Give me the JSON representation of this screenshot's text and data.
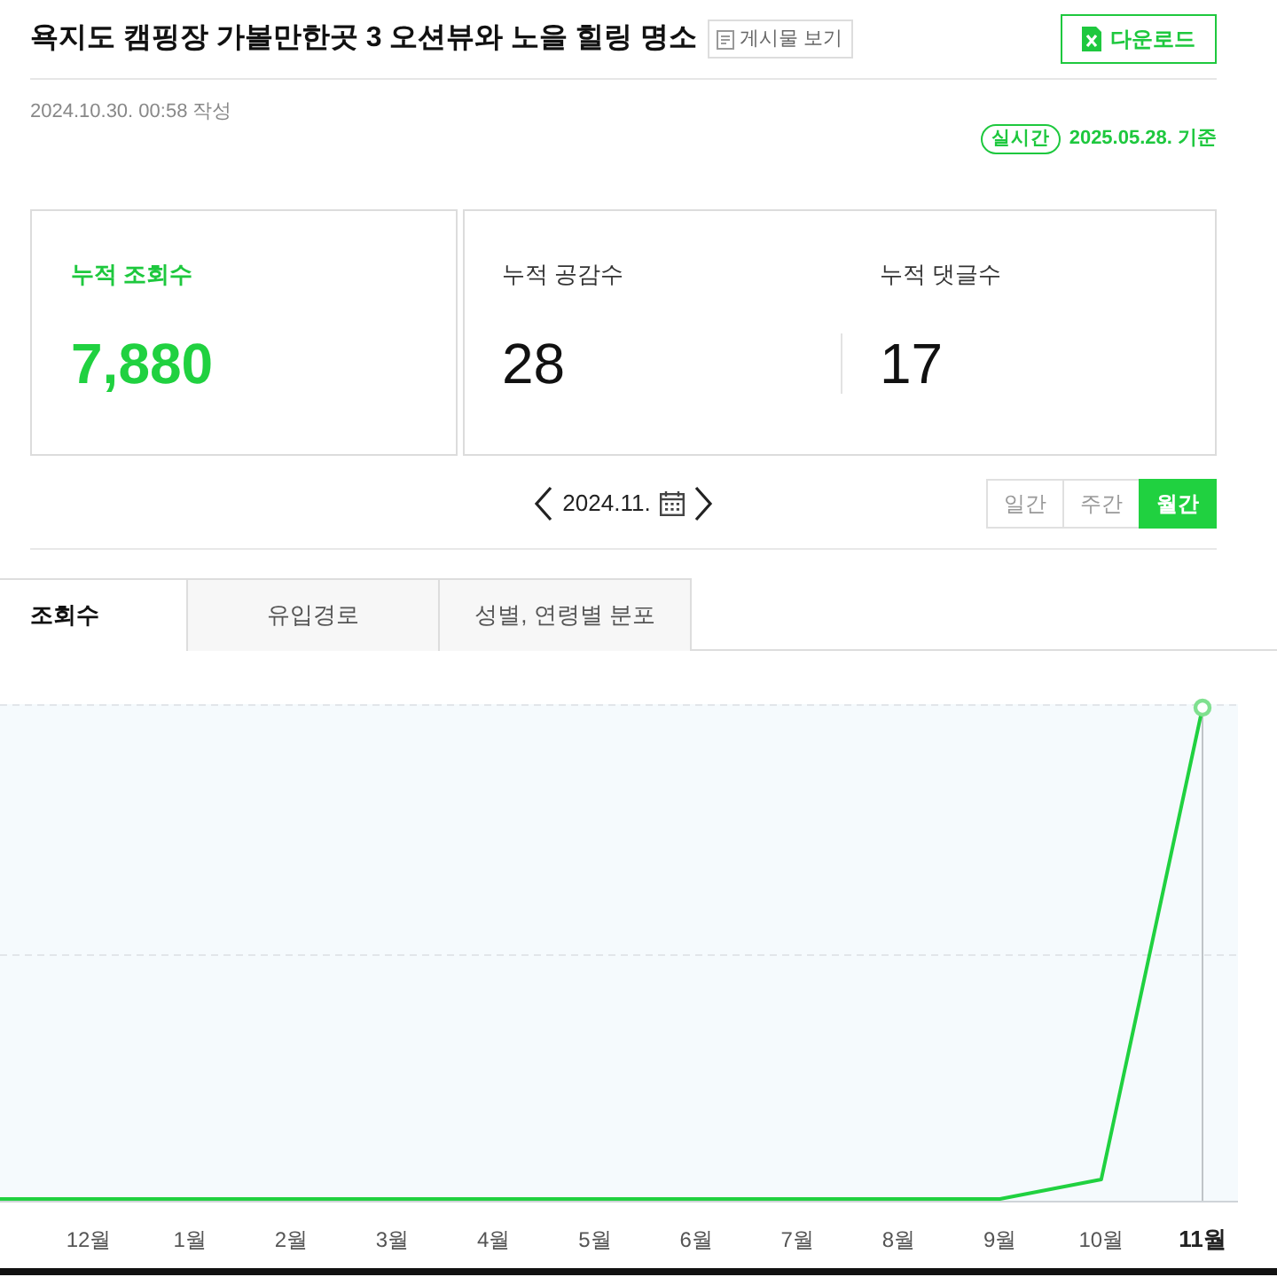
{
  "header": {
    "title": "욕지도 캠핑장 가볼만한곳 3 오션뷰와 노을 힐링 명소",
    "view_post_button": "게시물 보기",
    "download_button": "다운로드"
  },
  "meta": {
    "created": "2024.10.30. 00:58 작성",
    "realtime_badge": "실시간",
    "basis_date": "2025.05.28. 기준"
  },
  "stat_cards": [
    {
      "highlighted": true,
      "items": [
        {
          "label": "누적 조회수",
          "value": "7,880"
        }
      ]
    },
    {
      "highlighted": false,
      "items": [
        {
          "label": "누적 공감수",
          "value": "28"
        },
        {
          "label": "누적 댓글수",
          "value": "17"
        }
      ]
    }
  ],
  "date_nav": {
    "date": "2024.11."
  },
  "periods": [
    {
      "label": "일간",
      "selected": false
    },
    {
      "label": "주간",
      "selected": false
    },
    {
      "label": "월간",
      "selected": true
    }
  ],
  "tabs": [
    {
      "label": "조회수",
      "selected": true
    },
    {
      "label": "유입경로",
      "selected": false
    },
    {
      "label": "성별, 연령별 분포",
      "selected": false
    }
  ],
  "chart": {
    "x_labels": [
      {
        "label": "12월",
        "selected": false
      },
      {
        "label": "1월",
        "selected": false
      },
      {
        "label": "2월",
        "selected": false
      },
      {
        "label": "3월",
        "selected": false
      },
      {
        "label": "4월",
        "selected": false
      },
      {
        "label": "5월",
        "selected": false
      },
      {
        "label": "6월",
        "selected": false
      },
      {
        "label": "7월",
        "selected": false
      },
      {
        "label": "8월",
        "selected": false
      },
      {
        "label": "9월",
        "selected": false
      },
      {
        "label": "10월",
        "selected": false
      },
      {
        "label": "11월",
        "selected": true
      }
    ]
  }
}
